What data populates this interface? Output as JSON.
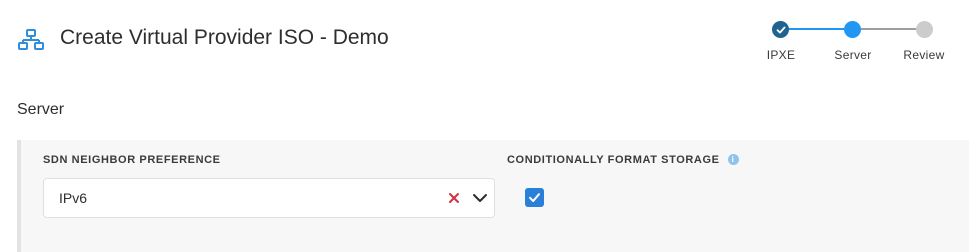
{
  "header": {
    "icon": "network-icon",
    "title": "Create Virtual Provider ISO - Demo"
  },
  "stepper": {
    "steps": [
      {
        "label": "IPXE",
        "state": "done"
      },
      {
        "label": "Server",
        "state": "active"
      },
      {
        "label": "Review",
        "state": "todo"
      }
    ],
    "colors": {
      "done": "#1f6391",
      "active": "#2196f3",
      "todo": "#cccccc"
    }
  },
  "section": {
    "title": "Server",
    "fields": {
      "sdn_neighbor_preference": {
        "label": "SDN NEIGHBOR PREFERENCE",
        "value": "IPv6"
      },
      "conditionally_format_storage": {
        "label": "CONDITIONALLY FORMAT STORAGE",
        "icon": "info-icon",
        "checked": true
      }
    }
  },
  "colors": {
    "accent": "#2196f3",
    "clear": "#d0323f",
    "checkbox": "#2a7fd8"
  }
}
